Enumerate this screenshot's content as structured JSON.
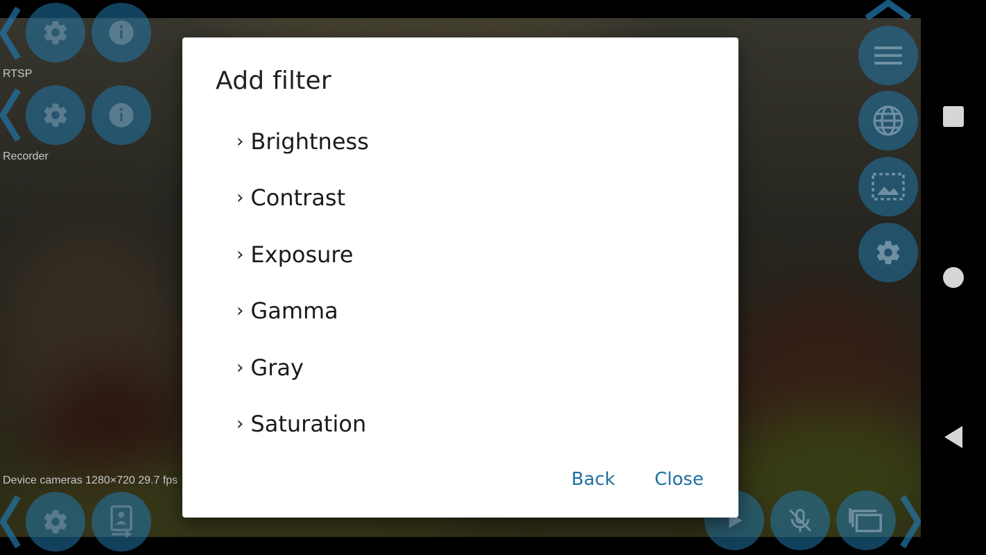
{
  "dialog": {
    "title": "Add filter",
    "items": [
      {
        "arrow": "›",
        "label": "Brightness"
      },
      {
        "arrow": "›",
        "label": "Contrast"
      },
      {
        "arrow": "›",
        "label": "Exposure"
      },
      {
        "arrow": "›",
        "label": "Gamma"
      },
      {
        "arrow": "›",
        "label": "Gray"
      },
      {
        "arrow": "›",
        "label": "Saturation"
      }
    ],
    "back_label": "Back",
    "close_label": "Close"
  },
  "left_panel": {
    "rtsp_label": "RTSP",
    "recorder_label": "Recorder",
    "status": "Device cameras 1280×720  29.7 fps"
  },
  "icons": {
    "left": [
      "chevron-left-icon",
      "gear-icon",
      "info-icon",
      "chevron-left-icon",
      "gear-icon",
      "info-icon",
      "chevron-left-icon",
      "gear-icon",
      "camera-switch-icon"
    ],
    "right": [
      "chevron-up-icon",
      "menu-icon",
      "globe-icon",
      "image-frame-icon",
      "gear-icon"
    ],
    "bottom_right": [
      "play-icon",
      "mic-off-icon",
      "layers-icon",
      "chevron-right-icon"
    ],
    "navbar": [
      "recents-square-icon",
      "home-circle-icon",
      "back-triangle-icon"
    ]
  },
  "colors": {
    "accent": "#1e6fa0",
    "control_circle": "#2176aa",
    "dialog_bg": "#ffffff"
  }
}
